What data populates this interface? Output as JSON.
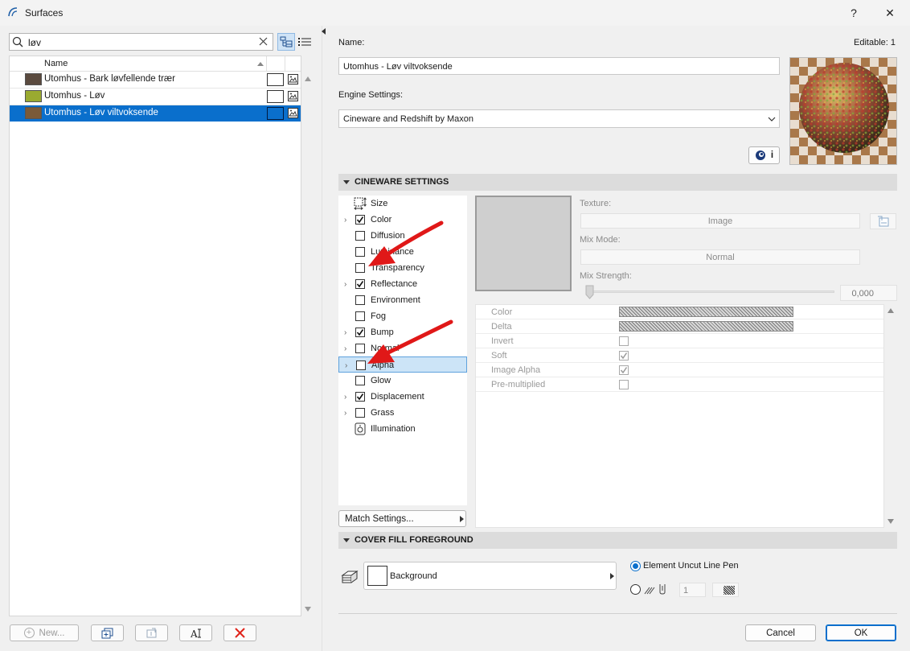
{
  "window": {
    "title": "Surfaces",
    "help": "?",
    "close": "✕"
  },
  "search": {
    "value": "løv"
  },
  "list": {
    "header_name": "Name",
    "items": [
      {
        "label": "Utomhus - Bark løvfellende trær",
        "color": "#5a4a3e"
      },
      {
        "label": "Utomhus - Løv",
        "color": "#9aaa30"
      },
      {
        "label": "Utomhus - Løv viltvoksende",
        "color": "#7a5a38"
      }
    ]
  },
  "bottom_buttons": {
    "new": "New..."
  },
  "right": {
    "name_label": "Name:",
    "editable": "Editable: 1",
    "name_value": "Utomhus - Løv viltvoksende",
    "engine_label": "Engine Settings:",
    "engine_value": "Cineware and Redshift by Maxon",
    "info_button": "i"
  },
  "cineware": {
    "header": "CINEWARE SETTINGS",
    "channels": [
      {
        "label": "Size",
        "type": "icon",
        "expand": false,
        "checked": false
      },
      {
        "label": "Color",
        "type": "checkbox",
        "expand": true,
        "checked": true
      },
      {
        "label": "Diffusion",
        "type": "checkbox",
        "expand": false,
        "checked": false
      },
      {
        "label": "Luminance",
        "type": "checkbox",
        "expand": false,
        "checked": false
      },
      {
        "label": "Transparency",
        "type": "checkbox",
        "expand": false,
        "checked": false
      },
      {
        "label": "Reflectance",
        "type": "checkbox",
        "expand": true,
        "checked": true
      },
      {
        "label": "Environment",
        "type": "checkbox",
        "expand": false,
        "checked": false
      },
      {
        "label": "Fog",
        "type": "checkbox",
        "expand": false,
        "checked": false
      },
      {
        "label": "Bump",
        "type": "checkbox",
        "expand": true,
        "checked": true
      },
      {
        "label": "Normal",
        "type": "checkbox",
        "expand": true,
        "checked": false
      },
      {
        "label": "Alpha",
        "type": "checkbox",
        "expand": true,
        "checked": false
      },
      {
        "label": "Glow",
        "type": "checkbox",
        "expand": false,
        "checked": false
      },
      {
        "label": "Displacement",
        "type": "checkbox",
        "expand": true,
        "checked": true
      },
      {
        "label": "Grass",
        "type": "checkbox",
        "expand": true,
        "checked": false
      },
      {
        "label": "Illumination",
        "type": "icon",
        "expand": false,
        "checked": false
      }
    ],
    "match_settings": "Match Settings...",
    "texture_label": "Texture:",
    "texture_value": "Image",
    "mix_mode_label": "Mix Mode:",
    "mix_mode_value": "Normal",
    "mix_strength_label": "Mix Strength:",
    "mix_strength_value": "0,000",
    "mix_strength_fraction": 0.0,
    "properties": [
      {
        "name": "Color",
        "kind": "hatch"
      },
      {
        "name": "Delta",
        "kind": "hatch"
      },
      {
        "name": "Invert",
        "kind": "checkbox",
        "checked": false
      },
      {
        "name": "Soft",
        "kind": "checkbox",
        "checked": true
      },
      {
        "name": "Image Alpha",
        "kind": "checkbox",
        "checked": true
      },
      {
        "name": "Pre-multiplied",
        "kind": "checkbox",
        "checked": false
      }
    ]
  },
  "cover_fill": {
    "header": "COVER FILL FOREGROUND",
    "background_label": "Background",
    "radio_option_1": "Element Uncut Line Pen",
    "pen_number": "1"
  },
  "footer": {
    "cancel": "Cancel",
    "ok": "OK"
  },
  "colors": {
    "accent": "#0a6fcc",
    "annotation_arrow": "#e01818",
    "selection_highlight": "#cce4f7"
  }
}
